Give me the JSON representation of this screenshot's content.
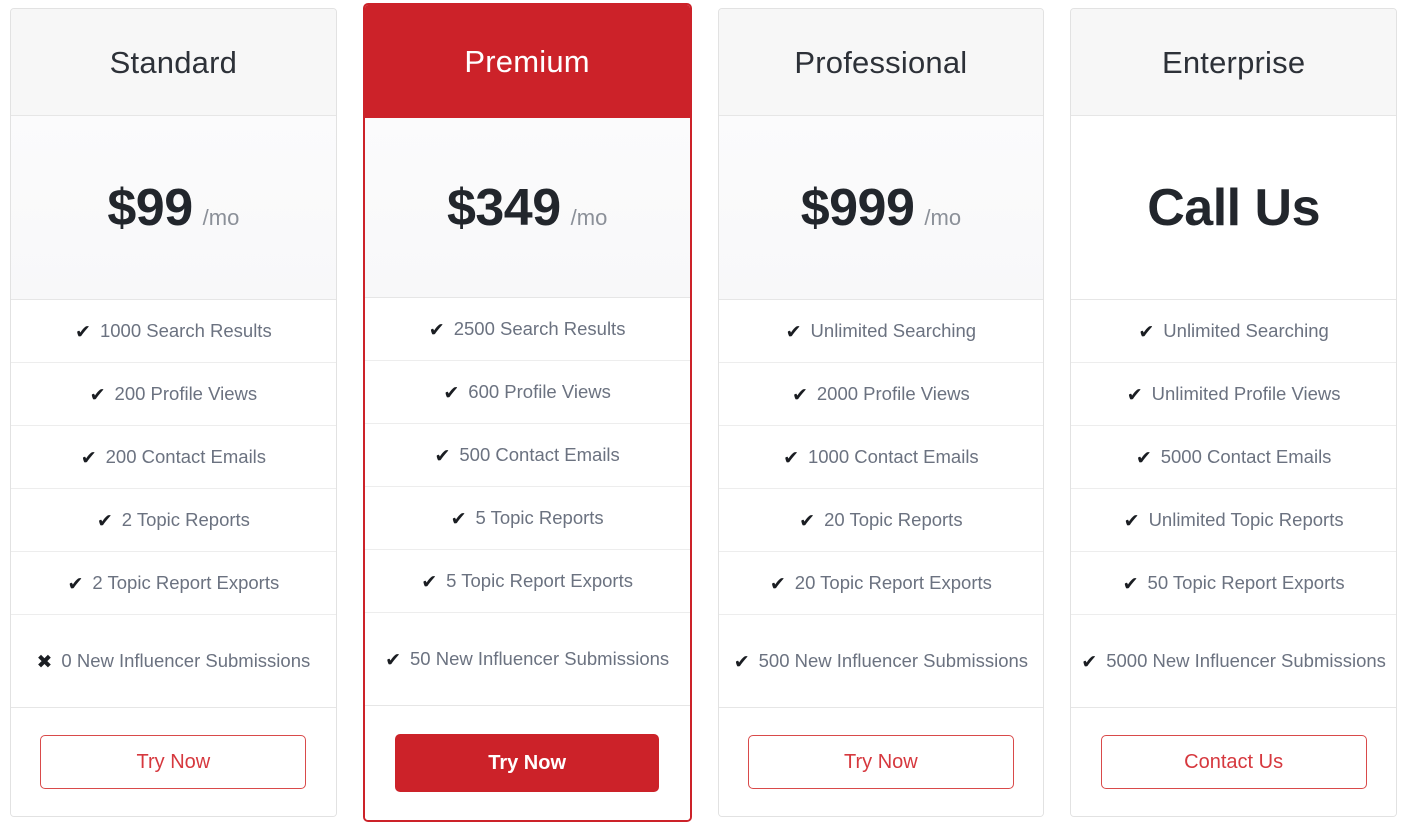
{
  "plans": [
    {
      "name": "Standard",
      "price": "$99",
      "period": "/mo",
      "featured": false,
      "plain_price_bg": false,
      "features": [
        {
          "icon": "check-icon",
          "glyph": "✔",
          "label": "1000 Search Results",
          "included": true
        },
        {
          "icon": "check-icon",
          "glyph": "✔",
          "label": "200 Profile Views",
          "included": true
        },
        {
          "icon": "check-icon",
          "glyph": "✔",
          "label": "200 Contact Emails",
          "included": true
        },
        {
          "icon": "check-icon",
          "glyph": "✔",
          "label": "2 Topic Reports",
          "included": true
        },
        {
          "icon": "check-icon",
          "glyph": "✔",
          "label": "2 Topic Report Exports",
          "included": true
        },
        {
          "icon": "cross-icon",
          "glyph": "✖",
          "label": "0 New Influencer Submissions",
          "included": false
        }
      ],
      "cta_label": "Try Now",
      "cta_style": "outline"
    },
    {
      "name": "Premium",
      "price": "$349",
      "period": "/mo",
      "featured": true,
      "plain_price_bg": false,
      "features": [
        {
          "icon": "check-icon",
          "glyph": "✔",
          "label": "2500 Search Results",
          "included": true
        },
        {
          "icon": "check-icon",
          "glyph": "✔",
          "label": "600 Profile Views",
          "included": true
        },
        {
          "icon": "check-icon",
          "glyph": "✔",
          "label": "500 Contact Emails",
          "included": true
        },
        {
          "icon": "check-icon",
          "glyph": "✔",
          "label": "5 Topic Reports",
          "included": true
        },
        {
          "icon": "check-icon",
          "glyph": "✔",
          "label": "5 Topic Report Exports",
          "included": true
        },
        {
          "icon": "check-icon",
          "glyph": "✔",
          "label": "50 New Influencer Submissions",
          "included": true
        }
      ],
      "cta_label": "Try Now",
      "cta_style": "solid"
    },
    {
      "name": "Professional",
      "price": "$999",
      "period": "/mo",
      "featured": false,
      "plain_price_bg": false,
      "features": [
        {
          "icon": "check-icon",
          "glyph": "✔",
          "label": "Unlimited Searching",
          "included": true
        },
        {
          "icon": "check-icon",
          "glyph": "✔",
          "label": "2000 Profile Views",
          "included": true
        },
        {
          "icon": "check-icon",
          "glyph": "✔",
          "label": "1000 Contact Emails",
          "included": true
        },
        {
          "icon": "check-icon",
          "glyph": "✔",
          "label": "20 Topic Reports",
          "included": true
        },
        {
          "icon": "check-icon",
          "glyph": "✔",
          "label": "20 Topic Report Exports",
          "included": true
        },
        {
          "icon": "check-icon",
          "glyph": "✔",
          "label": "500 New Influencer Submissions",
          "included": true
        }
      ],
      "cta_label": "Try Now",
      "cta_style": "outline"
    },
    {
      "name": "Enterprise",
      "price": "Call Us",
      "period": "",
      "featured": false,
      "plain_price_bg": true,
      "features": [
        {
          "icon": "check-icon",
          "glyph": "✔",
          "label": "Unlimited Searching",
          "included": true
        },
        {
          "icon": "check-icon",
          "glyph": "✔",
          "label": "Unlimited Profile Views",
          "included": true
        },
        {
          "icon": "check-icon",
          "glyph": "✔",
          "label": "5000 Contact Emails",
          "included": true
        },
        {
          "icon": "check-icon",
          "glyph": "✔",
          "label": "Unlimited Topic Reports",
          "included": true
        },
        {
          "icon": "check-icon",
          "glyph": "✔",
          "label": "50 Topic Report Exports",
          "included": true
        },
        {
          "icon": "check-icon",
          "glyph": "✔",
          "label": "5000 New Influencer Submissions",
          "included": true
        }
      ],
      "cta_label": "Contact Us",
      "cta_style": "outline"
    }
  ],
  "colors": {
    "accent_red": "#cc2229",
    "outline_red": "#d6383e",
    "header_bg": "#f7f7f7",
    "feature_text": "#6b7280",
    "title_text": "#2d3138",
    "price_text": "#22262c",
    "period_text": "#8b9098",
    "card_border": "#e2e2e2"
  }
}
